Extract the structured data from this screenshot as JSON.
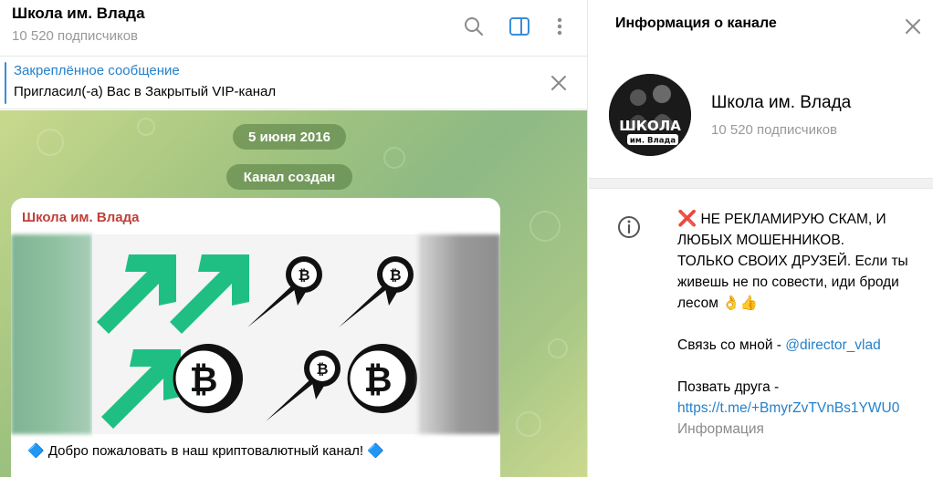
{
  "chat": {
    "title": "Школа им. Влада",
    "subscribers": "10 520 подписчиков",
    "pinned": {
      "title": "Закреплённое сообщение",
      "text": "Пригласил(-а) Вас в Закрытый VIP-канал"
    },
    "service": {
      "date": "5 июня 2016",
      "created": "Канал создан"
    },
    "message": {
      "author": "Школа им. Влада",
      "text": "🔷 Добро пожаловать в наш криптовалютный канал! 🔷"
    }
  },
  "info": {
    "title": "Информация о канале",
    "name": "Школа им. Влада",
    "subscribers": "10 520 подписчиков",
    "avatar": {
      "line1": "ШКОЛА",
      "line2": "им. Влада"
    },
    "description": {
      "line1_mark": "❌",
      "line1": " НЕ РЕКЛАМИРУЮ СКАМ, И ЛЮБЫХ МОШЕННИКОВ.",
      "line2": "ТОЛЬКО СВОИХ ДРУЗЕЙ. Если ты живешь не по совести, иди броди лесом 👌👍",
      "contact_prefix": "Связь со мной - ",
      "contact_handle": "@director_vlad",
      "invite_prefix": "Позвать друга -",
      "invite_link": "https://t.me/+BmyrZvTVnBs1YWU0",
      "label": "Информация"
    }
  },
  "icons": {
    "search": "search-icon",
    "sidebar_toggle": "sidebar-toggle-icon",
    "more": "more-vertical-icon",
    "close": "close-icon",
    "info": "info-icon"
  },
  "colors": {
    "accent": "#2481cc",
    "author": "#c0413a",
    "green_arrow": "#1fbf83"
  }
}
